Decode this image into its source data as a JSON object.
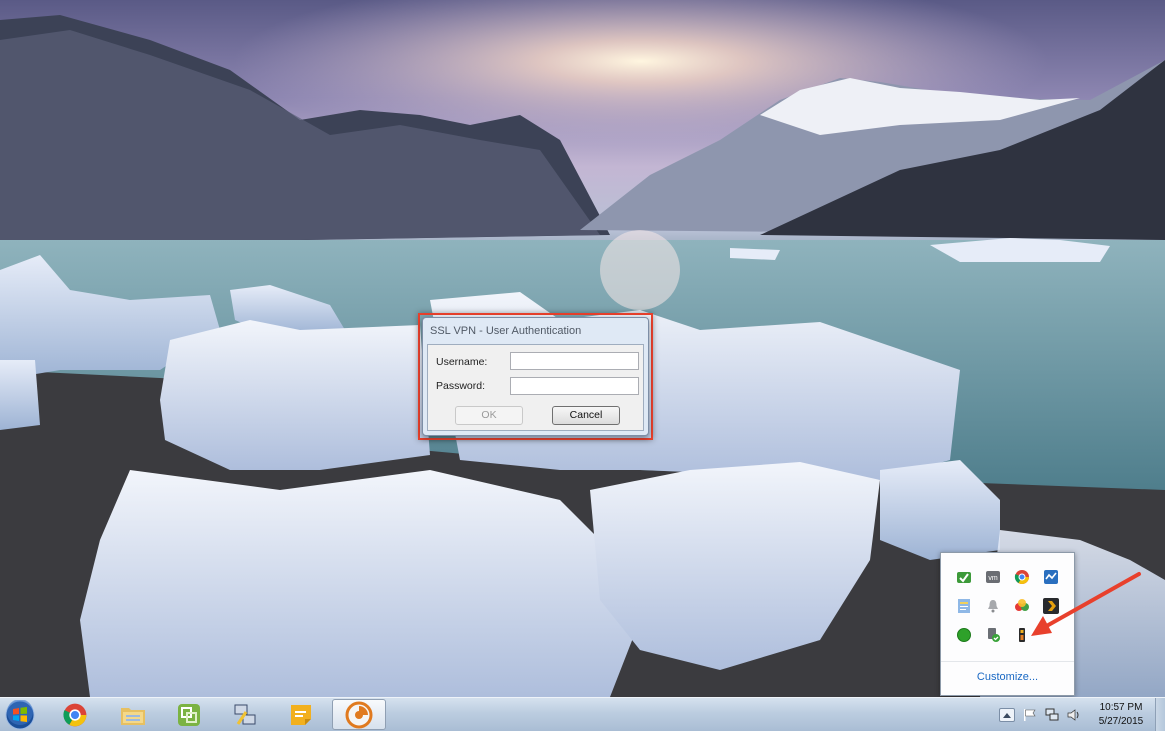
{
  "dialog": {
    "title": "SSL VPN - User Authentication",
    "username_label": "Username:",
    "password_label": "Password:",
    "username_value": "",
    "password_value": "",
    "ok_label": "OK",
    "cancel_label": "Cancel",
    "ok_enabled": false,
    "highlight_color": "#e8402c"
  },
  "tray_flyout": {
    "icons": [
      {
        "name": "sync-icon"
      },
      {
        "name": "vmware-icon"
      },
      {
        "name": "chrome-icon"
      },
      {
        "name": "network-monitor-icon"
      },
      {
        "name": "notes-icon"
      },
      {
        "name": "bell-icon"
      },
      {
        "name": "colorful-app-icon"
      },
      {
        "name": "plex-icon"
      },
      {
        "name": "green-status-icon"
      },
      {
        "name": "usb-security-icon"
      },
      {
        "name": "vpn-client-icon"
      }
    ],
    "customize_label": "Customize...",
    "annotation_arrow_color": "#e8402c"
  },
  "taskbar": {
    "apps": [
      {
        "name": "chrome-taskbar-button"
      },
      {
        "name": "explorer-taskbar-button"
      },
      {
        "name": "vsphere-taskbar-button"
      },
      {
        "name": "putty-taskbar-button"
      },
      {
        "name": "sticky-notes-taskbar-button"
      },
      {
        "name": "vpn-taskbar-button"
      }
    ],
    "clock_time": "10:57 PM",
    "clock_date": "5/27/2015"
  },
  "colors": {
    "taskbar": "#bccde0",
    "link": "#1a69c4",
    "dialog_frame": "#dfe9f5"
  }
}
